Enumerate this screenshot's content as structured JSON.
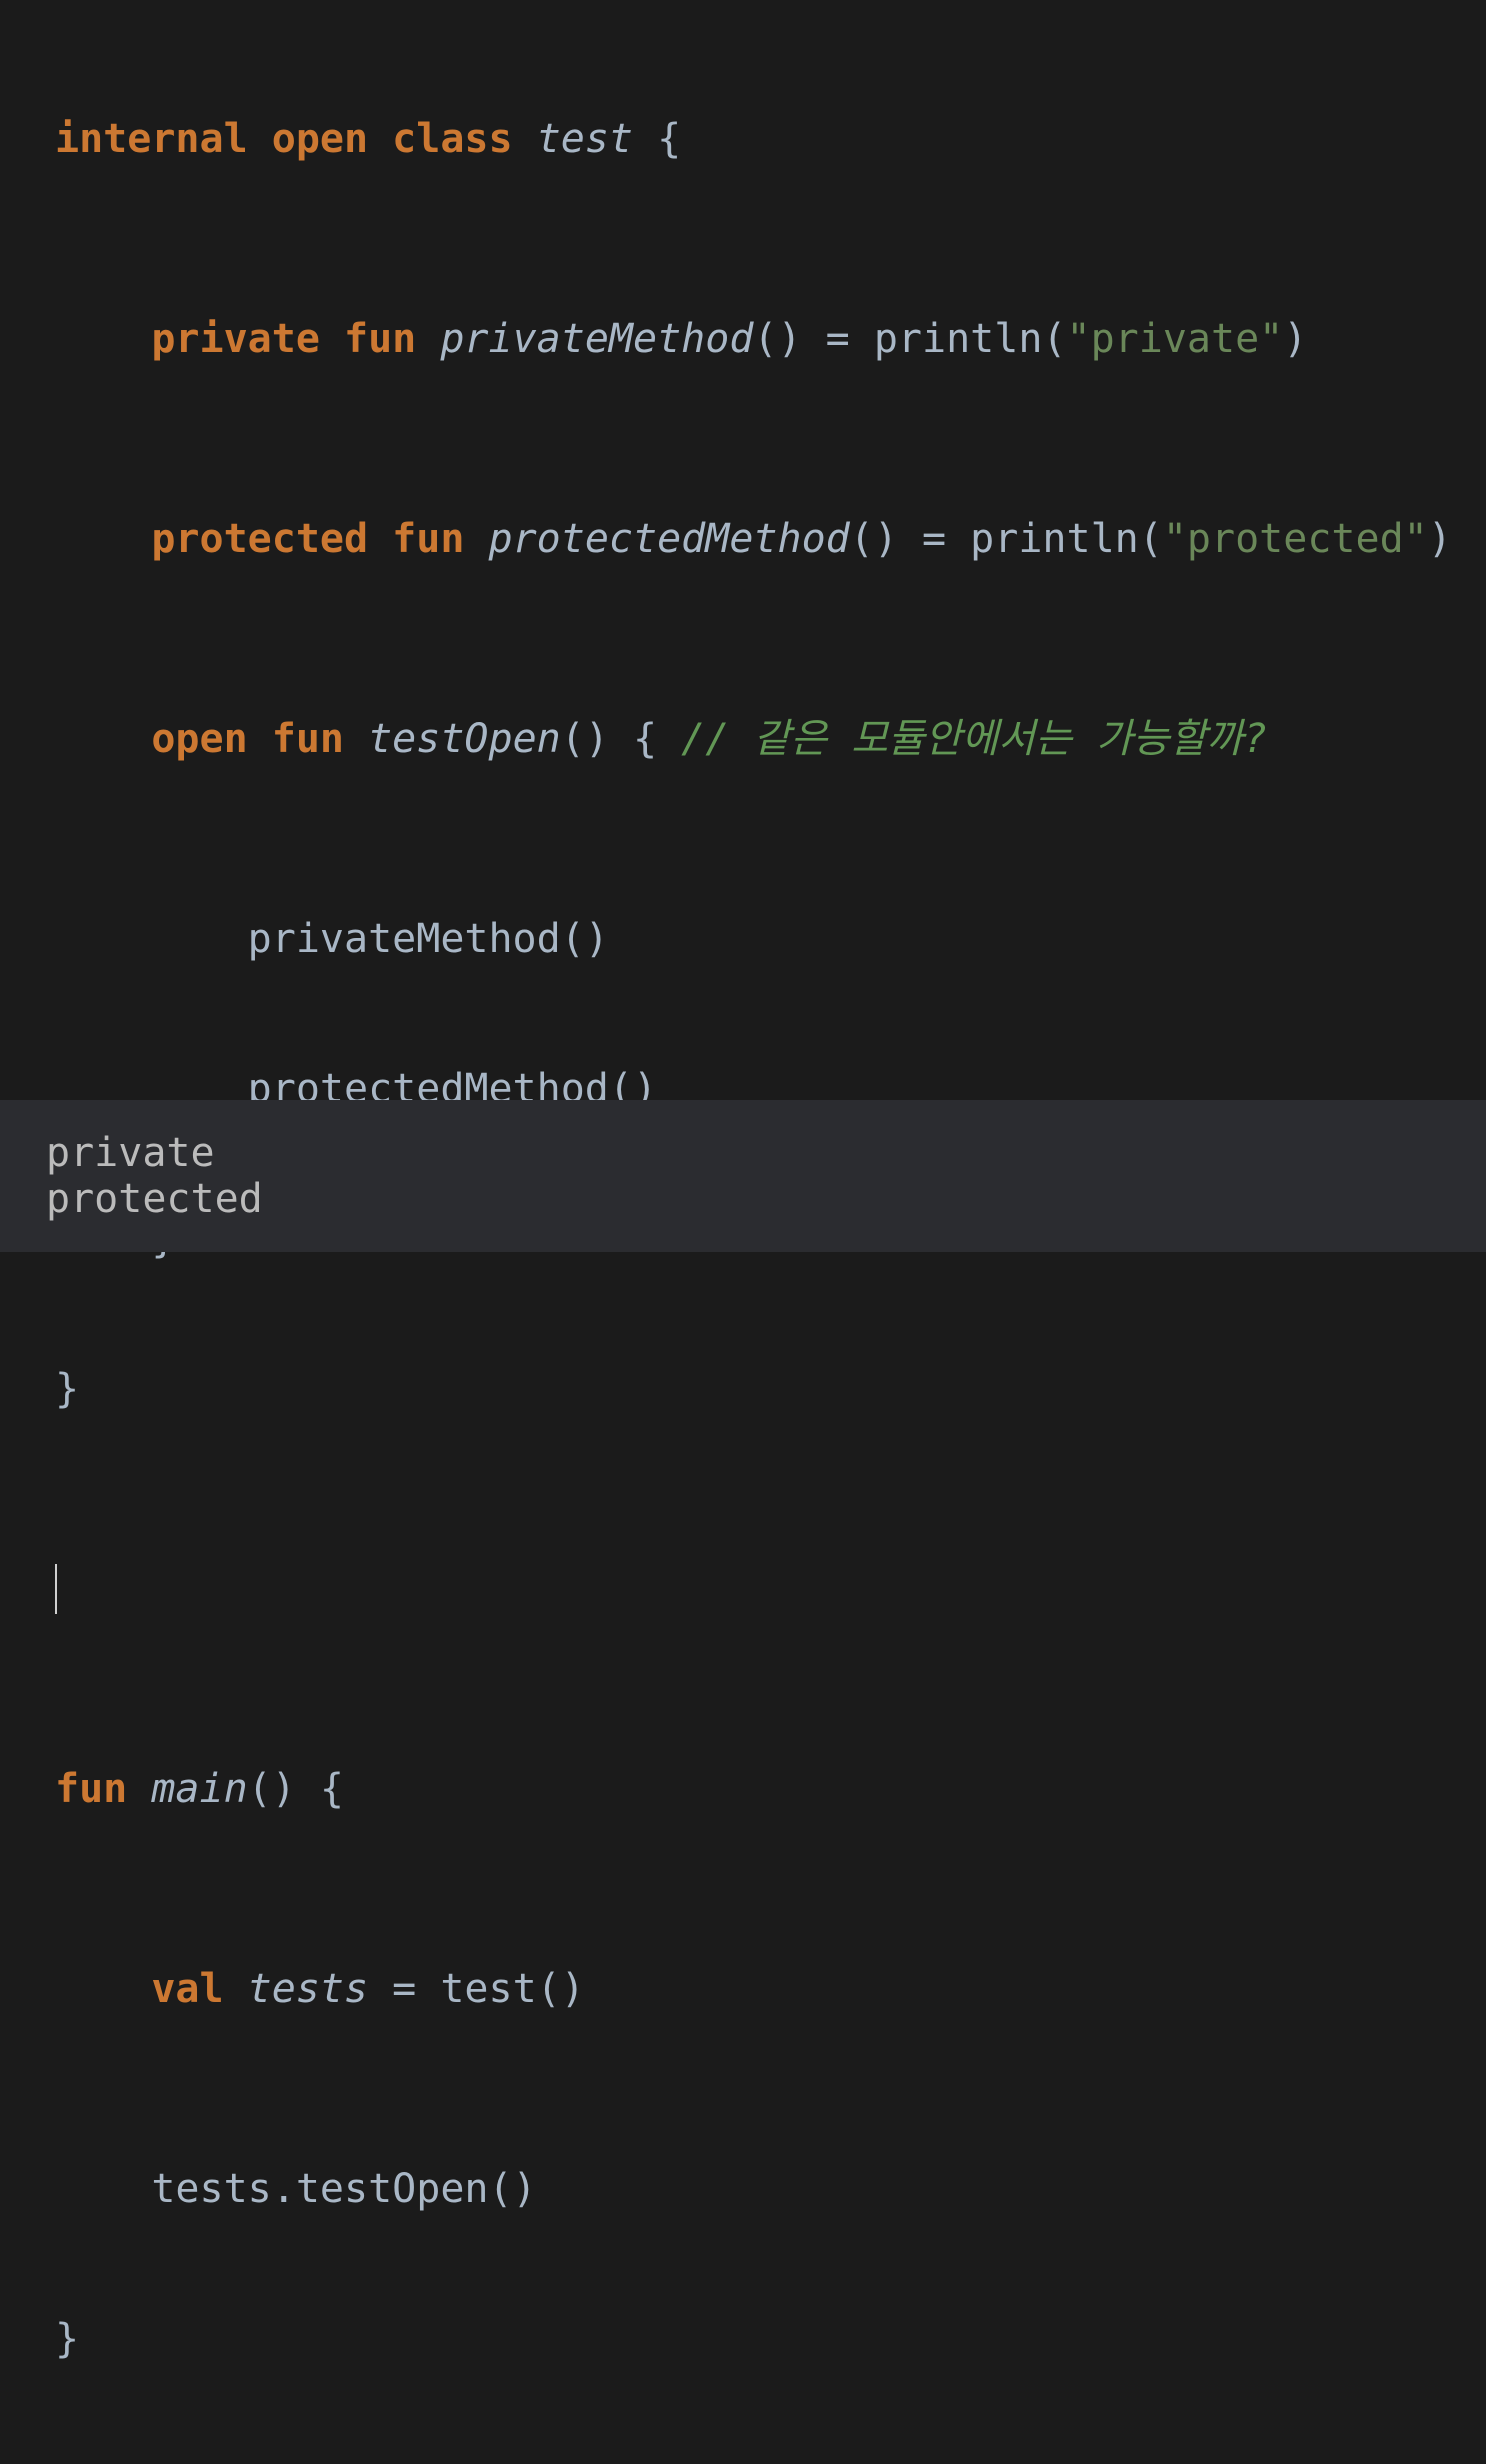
{
  "editor": {
    "line1": {
      "kw1": "internal",
      "sp1": " ",
      "kw2": "open",
      "sp2": " ",
      "kw3": "class",
      "sp3": " ",
      "name": "test",
      "rest": " {"
    },
    "line2": {
      "indent": "    ",
      "kw1": "private",
      "sp1": " ",
      "kw2": "fun",
      "sp2": " ",
      "name": "privateMethod",
      "mid": "() = println(",
      "str": "\"private\"",
      "end": ")"
    },
    "line3": {
      "indent": "    ",
      "kw1": "protected",
      "sp1": " ",
      "kw2": "fun",
      "sp2": " ",
      "name": "protectedMethod",
      "mid": "() = println(",
      "str": "\"protected\"",
      "end": ")"
    },
    "line4": {
      "indent": "    ",
      "kw1": "open",
      "sp1": " ",
      "kw2": "fun",
      "sp2": " ",
      "name": "testOpen",
      "mid": "() { ",
      "comment": "// 같은 모듈안에서는 가능할까?"
    },
    "line5": "        privateMethod()",
    "line6": "        protectedMethod()",
    "line7": "    }",
    "line8": "}",
    "line10": {
      "kw1": "fun",
      "sp1": " ",
      "name": "main",
      "rest": "() {"
    },
    "line11": {
      "indent": "    ",
      "kw1": "val",
      "sp1": " ",
      "name": "tests",
      "rest": " = test()"
    },
    "line12": "    tests.testOpen()",
    "line13": "}"
  },
  "console": {
    "lines": [
      "private",
      "protected"
    ]
  }
}
